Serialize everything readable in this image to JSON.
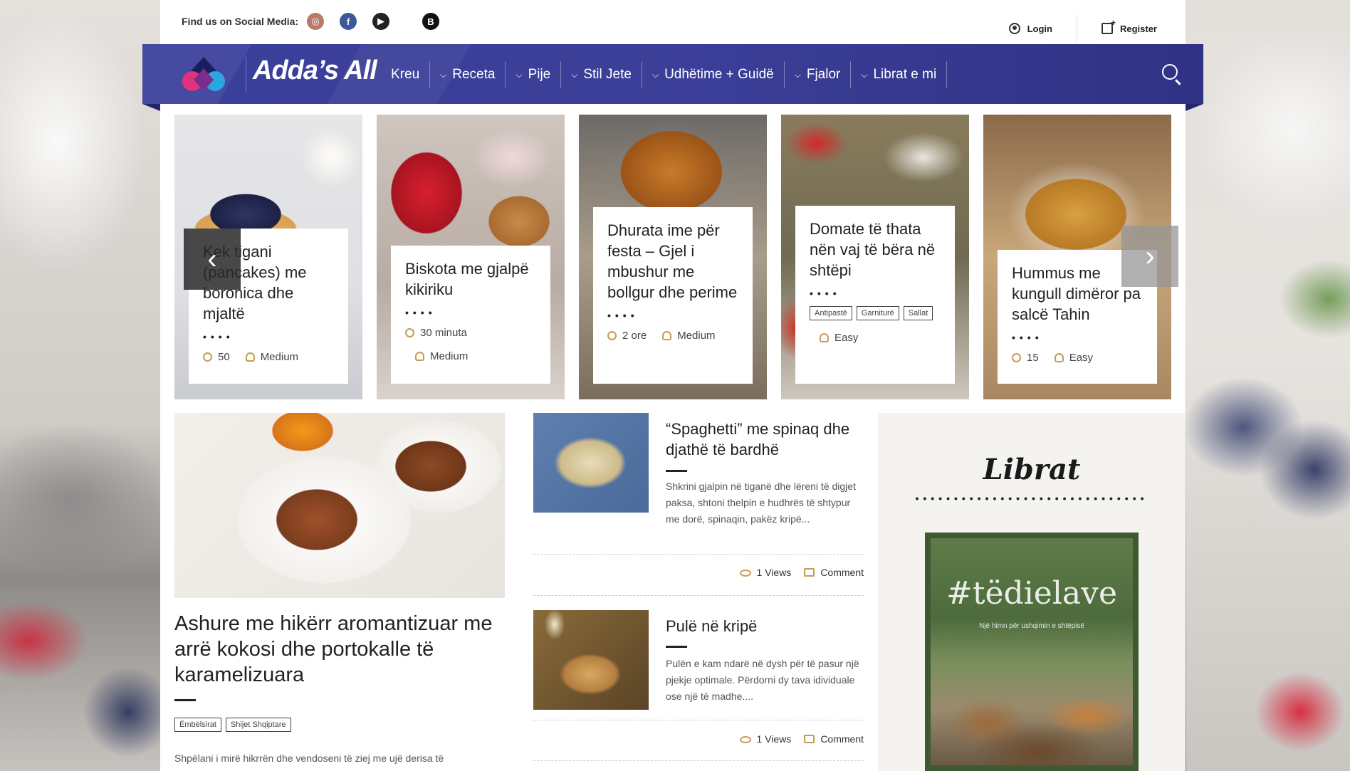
{
  "topbar": {
    "social_label": "Find us on Social Media:",
    "login": "Login",
    "register": "Register"
  },
  "nav": {
    "brand": "Adda’s All",
    "items": [
      {
        "label": "Kreu",
        "dropdown": false
      },
      {
        "label": "Receta",
        "dropdown": true
      },
      {
        "label": "Pije",
        "dropdown": true
      },
      {
        "label": "Stil Jete",
        "dropdown": true
      },
      {
        "label": "Udhëtime + Guidë",
        "dropdown": true
      },
      {
        "label": "Fjalor",
        "dropdown": true
      },
      {
        "label": "Librat e mi",
        "dropdown": true
      }
    ]
  },
  "carousel": {
    "cards": [
      {
        "title": "Kek tigani (pancakes) me boronica dhe mjaltë",
        "time": "50",
        "difficulty": "Medium"
      },
      {
        "title": "Biskota me gjalpë kikiriku",
        "time": "30 minuta",
        "difficulty": "Medium"
      },
      {
        "title": "Dhurata ime për festa – Gjel i mbushur me bollgur dhe perime",
        "time": "2 ore",
        "difficulty": "Medium"
      },
      {
        "title": "Domate të thata nën vaj të bëra në shtëpi",
        "tags": [
          "Antipastë",
          "Garniturë",
          "Sallat"
        ],
        "difficulty": "Easy"
      },
      {
        "title": "Hummus me kungull dimëror pa salcë Tahin",
        "time": "15",
        "difficulty": "Easy"
      }
    ]
  },
  "featured": {
    "title": "Ashure me hikërr aromantizuar me arrë kokosi dhe portokalle të karamelizuara",
    "tags": [
      "Ëmbëlsirat",
      "Shijet Shqiptare"
    ],
    "excerpt": "Shpëlani i mirë hikrrën dhe vendoseni të ziej me ujë derisa të"
  },
  "posts": [
    {
      "title": "“Spaghetti” me spinaq dhe djathë të bardhë",
      "excerpt": "Shkrini gjalpin në tiganë dhe lëreni të digjet paksa, shtoni thelpin e hudhrës të shtypur me dorë, spinaqin, pakëz kripë...",
      "views": "1 Views",
      "comment": "Comment"
    },
    {
      "title": "Pulë në kripë",
      "excerpt": "Pulën e  kam ndarë në dysh për të pasur një  pjekje optimale. Përdorni dy tava idividuale ose një të madhe....",
      "views": "1 Views",
      "comment": "Comment"
    }
  ],
  "sidebar": {
    "title": "Librat",
    "book_title": "#tëdielave",
    "book_subtitle": "Një himn për ushqimin e shtëpisë"
  },
  "colors": {
    "nav_bg": "#3a3f9a",
    "accent_gold": "#c79b52",
    "logo_pink": "#e0337e",
    "logo_blue": "#2aa6e0",
    "logo_navy": "#1b1e5e"
  }
}
